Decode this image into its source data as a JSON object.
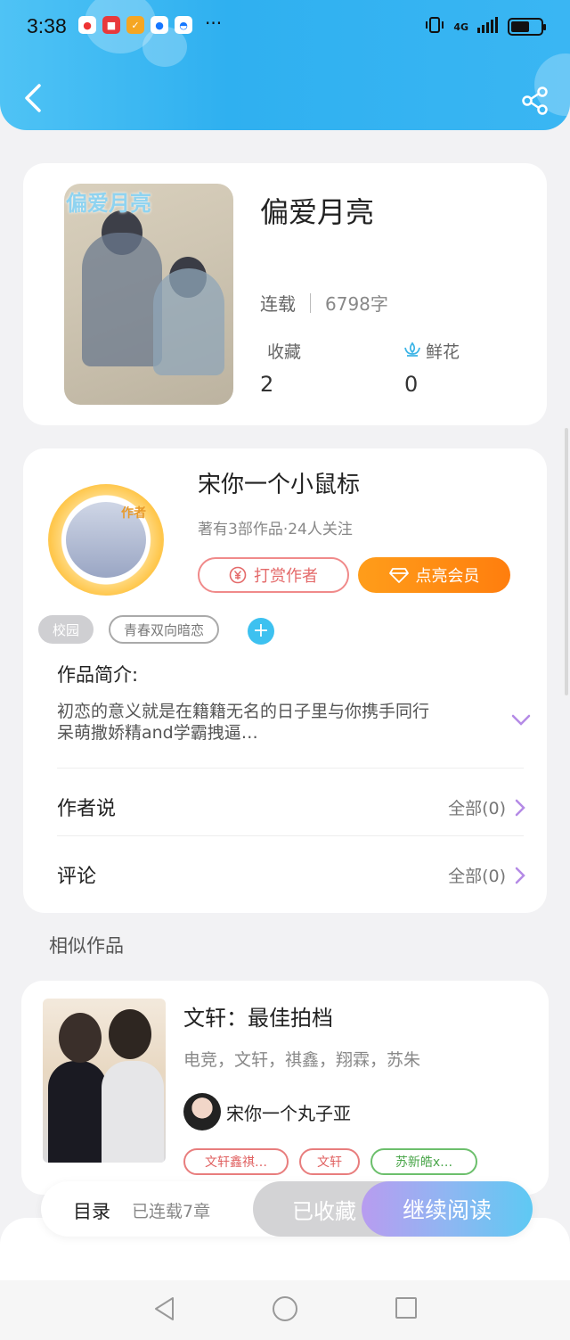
{
  "status_bar": {
    "time": "3:38",
    "network": "4G"
  },
  "book": {
    "cover_text": "偏爱月亮",
    "title": "偏爱月亮",
    "status": "连载",
    "word_count": "6798字",
    "favorites_label": "收藏",
    "favorites_value": "2",
    "flowers_label": "鲜花",
    "flowers_value": "0"
  },
  "author": {
    "avatar_tag": "作者",
    "name": "宋你一个小鼠标",
    "meta": "著有3部作品·24人关注",
    "reward_label": "打赏作者",
    "vip_label": "点亮会员",
    "tags": [
      "校园",
      "青春双向暗恋"
    ],
    "add_tag": "+"
  },
  "intro": {
    "title": "作品简介:",
    "text_line1": "初恋的意义就是在籍籍无名的日子里与你携手同行",
    "text_line2": "呆萌撒娇精and学霸拽逼…"
  },
  "rows": {
    "author_says": "作者说",
    "author_says_count": "全部(0)",
    "comments": "评论",
    "comments_count": "全部(0)"
  },
  "similar": {
    "section_title": "相似作品",
    "title": "文轩：最佳拍档",
    "tags_line": "电竞，文轩，祺鑫，翔霖，苏朱",
    "author": "宋你一个丸子亚",
    "tags": [
      "文轩鑫祺…",
      "文轩",
      "苏新皓x…"
    ]
  },
  "bottom_bar": {
    "toc": "目录",
    "chapters": "已连载7章",
    "collected": "已收藏",
    "continue": "继续阅读"
  },
  "colors": {
    "header": "#3ab6f3",
    "vip": "#ff8c10",
    "reward": "#e46a6a",
    "accent_purple": "#b48ae6"
  }
}
